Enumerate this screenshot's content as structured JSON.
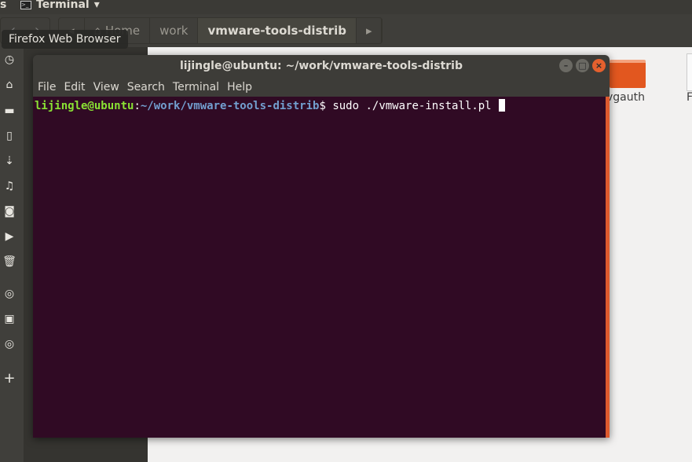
{
  "topbar": {
    "left_fragment": "s",
    "app_name": "Terminal",
    "dropdown": "▾"
  },
  "toolbar": {
    "back": "‹",
    "forward": "›",
    "crumb_left": "◂",
    "crumbs": [
      "⌂ Home",
      "work",
      "vmware-tools-distrib"
    ],
    "crumb_right": "▸"
  },
  "tooltip": "Firefox Web Browser",
  "launcher": {
    "icons": [
      "◷",
      "⌂",
      "▬",
      "▯",
      "⇣",
      "♫",
      "◙",
      "▶",
      "🗑",
      "◎",
      "▣",
      "◎",
      "+"
    ]
  },
  "files": {
    "items": [
      {
        "label": "vgauth"
      },
      {
        "label": "F"
      }
    ]
  },
  "terminal": {
    "title": "lijingle@ubuntu: ~/work/vmware-tools-distrib",
    "menu": [
      "File",
      "Edit",
      "View",
      "Search",
      "Terminal",
      "Help"
    ],
    "prompt_user": "lijingle@ubuntu",
    "prompt_sep": ":",
    "prompt_path": "~/work/vmware-tools-distrib",
    "prompt_end": "$ ",
    "command": "sudo ./vmware-install.pl ",
    "buttons": {
      "minimize": "–",
      "maximize": "□",
      "close": "×"
    }
  },
  "colors": {
    "terminal_bg": "#300a24",
    "accent": "#e2571f",
    "user": "#8ae234",
    "path": "#729fcf"
  }
}
